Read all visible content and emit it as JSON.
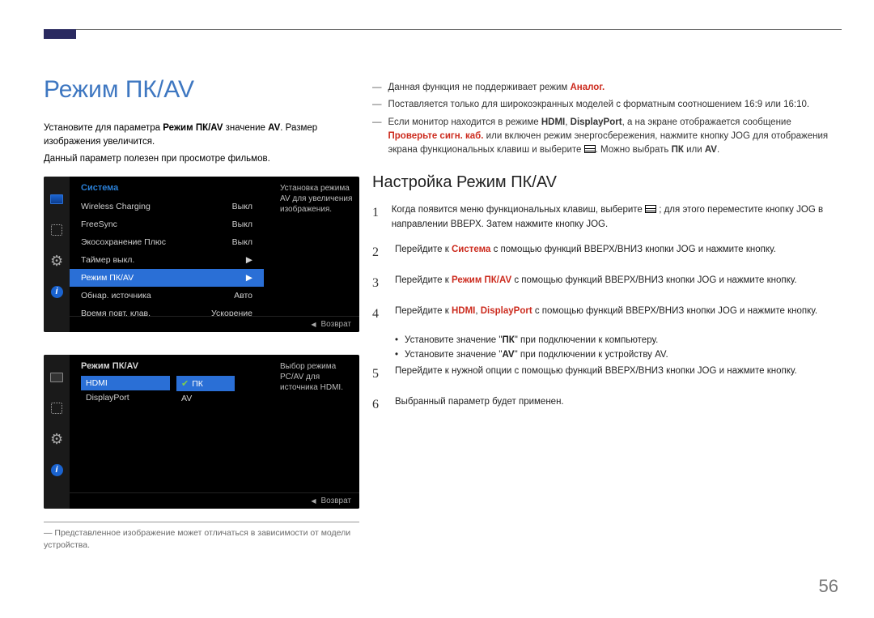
{
  "page_number": "56",
  "title": "Режим ПК/AV",
  "intro": {
    "p1_a": "Установите для параметра ",
    "p1_b": "Режим ПК/AV",
    "p1_c": " значение ",
    "p1_d": "AV",
    "p1_e": ". Размер изображения увеличится.",
    "p2": "Данный параметр полезен при просмотре фильмов."
  },
  "osd1": {
    "title": "Система",
    "help": "Установка режима AV для увеличения изображения.",
    "rows": [
      {
        "label": "Wireless Charging",
        "value": "Выкл"
      },
      {
        "label": "FreeSync",
        "value": "Выкл"
      },
      {
        "label": "Экосохранение Плюс",
        "value": "Выкл"
      },
      {
        "label": "Таймер выкл.",
        "value": "▶"
      },
      {
        "label": "Режим ПК/AV",
        "value": "▶",
        "selected": true
      },
      {
        "label": "Обнар. источника",
        "value": "Авто"
      },
      {
        "label": "Время повт. клав.",
        "value": "Ускорение"
      }
    ],
    "footer": "Возврат"
  },
  "osd2": {
    "title": "Режим ПК/AV",
    "help": "Выбор режима PC/AV для источника HDMI.",
    "col_a": [
      {
        "label": "HDMI",
        "selected": true
      },
      {
        "label": "DisplayPort"
      }
    ],
    "col_b": [
      {
        "label": "ПК",
        "checked": true
      },
      {
        "label": "AV"
      }
    ],
    "footer": "Возврат"
  },
  "footnote": "Представленное изображение может отличаться в зависимости от модели устройства.",
  "right": {
    "bullets": [
      {
        "pre": "Данная функция не поддерживает режим ",
        "em": "Аналог.",
        "post": ""
      },
      {
        "text": "Поставляется только для широкоэкранных моделей с форматным соотношением 16:9 или 16:10."
      },
      {
        "pre": "Если монитор находится в режиме ",
        "em1": "HDMI",
        "mid_a": ", ",
        "em2": "DisplayPort",
        "mid_b": ", а на экране отображается сообщение ",
        "em3": "Проверьте сигн. каб.",
        "post_a": " или включен режим энергосбережения, нажмите кнопку JOG для отображения экрана функциональных клавиш и выберите ",
        "icon": true,
        "post_b": ". Можно выбрать ",
        "em4": "ПК",
        "or": " или ",
        "em5": "AV",
        "end": "."
      }
    ],
    "h2": "Настройка Режим ПК/AV",
    "steps": [
      {
        "n": "1",
        "pre": "Когда появится меню функциональных клавиш, выберите ",
        "icon": true,
        "post": " ; для этого переместите кнопку JOG в направлении ВВЕРХ. Затем нажмите кнопку JOG."
      },
      {
        "n": "2",
        "pre": "Перейдите к ",
        "em": "Система",
        "post": " с помощью функций ВВЕРХ/ВНИЗ кнопки JOG и нажмите кнопку."
      },
      {
        "n": "3",
        "pre": "Перейдите к ",
        "em": "Режим ПК/AV",
        "post": " с помощью функций ВВЕРХ/ВНИЗ кнопки JOG и нажмите кнопку."
      },
      {
        "n": "4",
        "pre": "Перейдите к ",
        "em1": "HDMI",
        "mid": ", ",
        "em2": "DisplayPort",
        "post": " с помощью функций ВВЕРХ/ВНИЗ кнопки JOG и нажмите кнопку."
      },
      {
        "n": "5",
        "text": "Перейдите к нужной опции с помощью функций ВВЕРХ/ВНИЗ кнопки JOG и нажмите кнопку."
      },
      {
        "n": "6",
        "text": "Выбранный параметр будет применен."
      }
    ],
    "subs": [
      {
        "pre": "Установите значение \"",
        "em": "ПК",
        "post": "\" при подключении к компьютеру."
      },
      {
        "pre": "Установите значение \"",
        "em": "AV",
        "post": "\" при подключении к устройству AV."
      }
    ]
  }
}
